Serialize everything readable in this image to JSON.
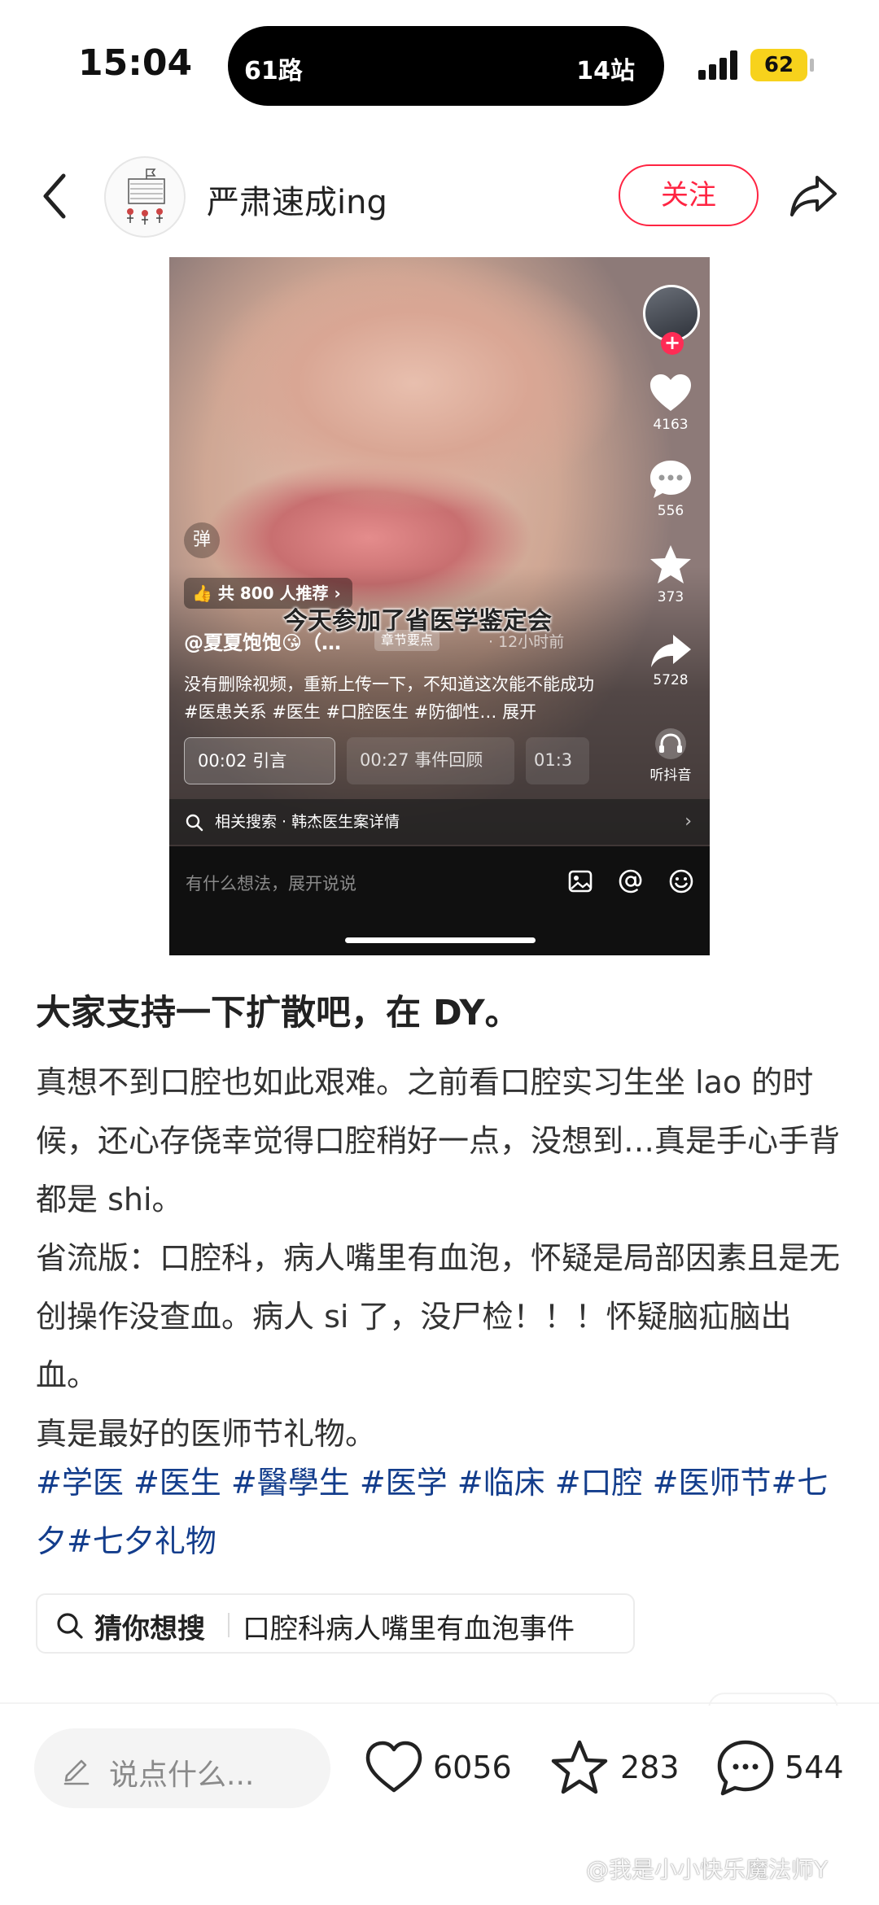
{
  "status_bar": {
    "time": "15:04",
    "island_route": "61路",
    "island_stops": "14站",
    "battery": "62"
  },
  "header": {
    "author_name": "严肃速成ing",
    "follow_label": "关注"
  },
  "embedded_screenshot": {
    "danmaku_label": "弹",
    "recommend_label": "共 800 人推荐",
    "subtitle": "今天参加了省医学鉴定会",
    "uploader": "@夏夏饱饱😘（…",
    "chapter_label": "章节要点",
    "time_ago": "· 12小时前",
    "description": "没有删除视频，重新上传一下，不知道这次能不能成功#医患关系 #医生 #口腔医生 #防御性… 展开",
    "chapters": [
      "00:02 引言",
      "00:27 事件回顾",
      "01:3"
    ],
    "related_search": "相关搜索 · 韩杰医生案详情",
    "likes": "4163",
    "comments": "556",
    "favorites": "373",
    "shares": "5728",
    "listen_label": "听抖音",
    "comment_placeholder": "有什么想法，展开说说"
  },
  "note": {
    "title": "大家支持一下扩散吧，在 DY。",
    "paragraphs": [
      "真想不到口腔也如此艰难。之前看口腔实习生坐 lao 的时候，还心存侥幸觉得口腔稍好一点，没想到…真是手心手背都是 shi。",
      "省流版：口腔科，病人嘴里有血泡，怀疑是局部因素且是无创操作没查血。病人 si 了，没尸检！！！怀疑脑疝脑出血。",
      "真是最好的医师节礼物。"
    ],
    "tags": [
      "#学医",
      "#医生",
      "#醫學生",
      "#医学",
      "#临床",
      "#口腔",
      "#医师节",
      "#七夕",
      "#七夕礼物"
    ]
  },
  "search_suggestion": {
    "label": "猜你想搜",
    "query": "口腔科病人嘴里有血泡事件"
  },
  "bottom_bar": {
    "comment_placeholder": "说点什么...",
    "likes": "6056",
    "favorites": "283",
    "comments": "544"
  },
  "watermark": "@我是小小快乐魔法师Y",
  "colors": {
    "accent": "#ff2442",
    "tag_blue": "#133d8c",
    "battery": "#f7d21c"
  },
  "icons": [
    "back-arrow-icon",
    "share-arrow-icon",
    "heart-icon",
    "star-icon",
    "comment-bubble-icon",
    "search-icon",
    "pen-icon",
    "image-icon",
    "at-icon",
    "emoji-icon",
    "headphones-icon"
  ]
}
